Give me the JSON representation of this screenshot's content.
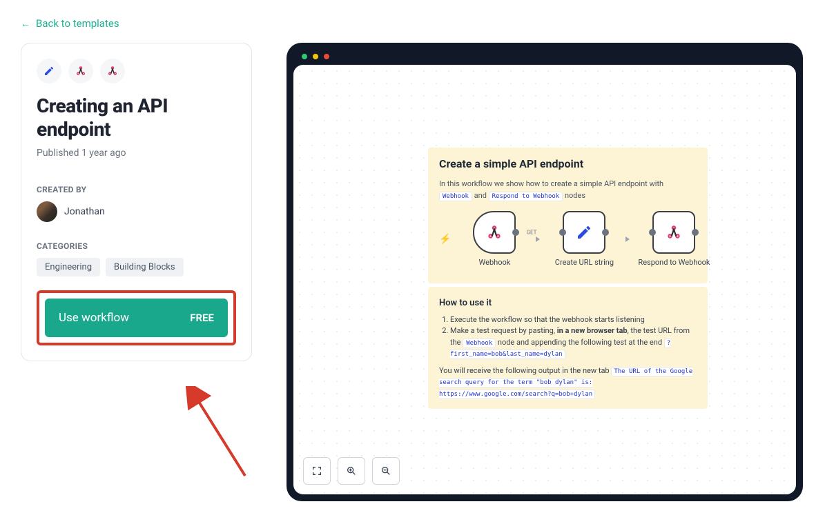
{
  "back_link": "Back to templates",
  "card": {
    "title": "Creating an API endpoint",
    "published": "Published 1 year ago",
    "created_by_label": "CREATED BY",
    "author": "Jonathan",
    "categories_label": "CATEGORIES",
    "categories": [
      "Engineering",
      "Building Blocks"
    ],
    "cta_label": "Use workflow",
    "cta_badge": "FREE"
  },
  "preview": {
    "sticky1": {
      "title": "Create a simple API endpoint",
      "desc_prefix": "In this workflow we show how to create a simple API endpoint with ",
      "chip1": "Webhook",
      "desc_mid": " and ",
      "chip2": "Respond to Webhook",
      "desc_suffix": " nodes",
      "get_label": "GET",
      "nodes": [
        "Webhook",
        "Create URL string",
        "Respond to Webhook"
      ]
    },
    "sticky2": {
      "title": "How to use it",
      "step1": "Execute the workflow so that the webhook starts listening",
      "step2_a": "Make a test request by pasting, ",
      "step2_bold": "in a new browser tab",
      "step2_b": ", the test URL from the ",
      "step2_chip": "Webhook",
      "step2_c": " node and appending the following test at the end ",
      "step2_query": "?first_name=bob&last_name=dylan",
      "result_prefix": "You will receive the following output in the new tab ",
      "result_chip": "The URL of the Google search query for the term \"bob dylan\" is: https://www.google.com/search?q=bob+dylan"
    }
  }
}
